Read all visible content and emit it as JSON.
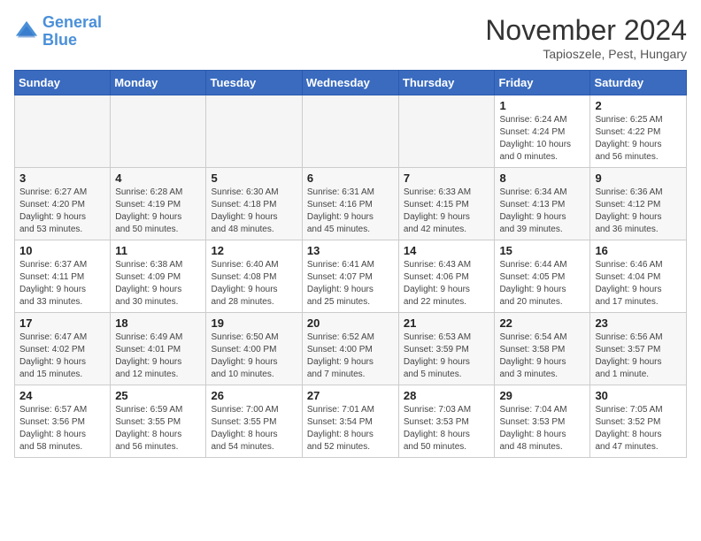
{
  "header": {
    "logo_line1": "General",
    "logo_line2": "Blue",
    "month_title": "November 2024",
    "subtitle": "Tapioszele, Pest, Hungary"
  },
  "weekdays": [
    "Sunday",
    "Monday",
    "Tuesday",
    "Wednesday",
    "Thursday",
    "Friday",
    "Saturday"
  ],
  "weeks": [
    [
      {
        "day": "",
        "info": ""
      },
      {
        "day": "",
        "info": ""
      },
      {
        "day": "",
        "info": ""
      },
      {
        "day": "",
        "info": ""
      },
      {
        "day": "",
        "info": ""
      },
      {
        "day": "1",
        "info": "Sunrise: 6:24 AM\nSunset: 4:24 PM\nDaylight: 10 hours\nand 0 minutes."
      },
      {
        "day": "2",
        "info": "Sunrise: 6:25 AM\nSunset: 4:22 PM\nDaylight: 9 hours\nand 56 minutes."
      }
    ],
    [
      {
        "day": "3",
        "info": "Sunrise: 6:27 AM\nSunset: 4:20 PM\nDaylight: 9 hours\nand 53 minutes."
      },
      {
        "day": "4",
        "info": "Sunrise: 6:28 AM\nSunset: 4:19 PM\nDaylight: 9 hours\nand 50 minutes."
      },
      {
        "day": "5",
        "info": "Sunrise: 6:30 AM\nSunset: 4:18 PM\nDaylight: 9 hours\nand 48 minutes."
      },
      {
        "day": "6",
        "info": "Sunrise: 6:31 AM\nSunset: 4:16 PM\nDaylight: 9 hours\nand 45 minutes."
      },
      {
        "day": "7",
        "info": "Sunrise: 6:33 AM\nSunset: 4:15 PM\nDaylight: 9 hours\nand 42 minutes."
      },
      {
        "day": "8",
        "info": "Sunrise: 6:34 AM\nSunset: 4:13 PM\nDaylight: 9 hours\nand 39 minutes."
      },
      {
        "day": "9",
        "info": "Sunrise: 6:36 AM\nSunset: 4:12 PM\nDaylight: 9 hours\nand 36 minutes."
      }
    ],
    [
      {
        "day": "10",
        "info": "Sunrise: 6:37 AM\nSunset: 4:11 PM\nDaylight: 9 hours\nand 33 minutes."
      },
      {
        "day": "11",
        "info": "Sunrise: 6:38 AM\nSunset: 4:09 PM\nDaylight: 9 hours\nand 30 minutes."
      },
      {
        "day": "12",
        "info": "Sunrise: 6:40 AM\nSunset: 4:08 PM\nDaylight: 9 hours\nand 28 minutes."
      },
      {
        "day": "13",
        "info": "Sunrise: 6:41 AM\nSunset: 4:07 PM\nDaylight: 9 hours\nand 25 minutes."
      },
      {
        "day": "14",
        "info": "Sunrise: 6:43 AM\nSunset: 4:06 PM\nDaylight: 9 hours\nand 22 minutes."
      },
      {
        "day": "15",
        "info": "Sunrise: 6:44 AM\nSunset: 4:05 PM\nDaylight: 9 hours\nand 20 minutes."
      },
      {
        "day": "16",
        "info": "Sunrise: 6:46 AM\nSunset: 4:04 PM\nDaylight: 9 hours\nand 17 minutes."
      }
    ],
    [
      {
        "day": "17",
        "info": "Sunrise: 6:47 AM\nSunset: 4:02 PM\nDaylight: 9 hours\nand 15 minutes."
      },
      {
        "day": "18",
        "info": "Sunrise: 6:49 AM\nSunset: 4:01 PM\nDaylight: 9 hours\nand 12 minutes."
      },
      {
        "day": "19",
        "info": "Sunrise: 6:50 AM\nSunset: 4:00 PM\nDaylight: 9 hours\nand 10 minutes."
      },
      {
        "day": "20",
        "info": "Sunrise: 6:52 AM\nSunset: 4:00 PM\nDaylight: 9 hours\nand 7 minutes."
      },
      {
        "day": "21",
        "info": "Sunrise: 6:53 AM\nSunset: 3:59 PM\nDaylight: 9 hours\nand 5 minutes."
      },
      {
        "day": "22",
        "info": "Sunrise: 6:54 AM\nSunset: 3:58 PM\nDaylight: 9 hours\nand 3 minutes."
      },
      {
        "day": "23",
        "info": "Sunrise: 6:56 AM\nSunset: 3:57 PM\nDaylight: 9 hours\nand 1 minute."
      }
    ],
    [
      {
        "day": "24",
        "info": "Sunrise: 6:57 AM\nSunset: 3:56 PM\nDaylight: 8 hours\nand 58 minutes."
      },
      {
        "day": "25",
        "info": "Sunrise: 6:59 AM\nSunset: 3:55 PM\nDaylight: 8 hours\nand 56 minutes."
      },
      {
        "day": "26",
        "info": "Sunrise: 7:00 AM\nSunset: 3:55 PM\nDaylight: 8 hours\nand 54 minutes."
      },
      {
        "day": "27",
        "info": "Sunrise: 7:01 AM\nSunset: 3:54 PM\nDaylight: 8 hours\nand 52 minutes."
      },
      {
        "day": "28",
        "info": "Sunrise: 7:03 AM\nSunset: 3:53 PM\nDaylight: 8 hours\nand 50 minutes."
      },
      {
        "day": "29",
        "info": "Sunrise: 7:04 AM\nSunset: 3:53 PM\nDaylight: 8 hours\nand 48 minutes."
      },
      {
        "day": "30",
        "info": "Sunrise: 7:05 AM\nSunset: 3:52 PM\nDaylight: 8 hours\nand 47 minutes."
      }
    ]
  ]
}
